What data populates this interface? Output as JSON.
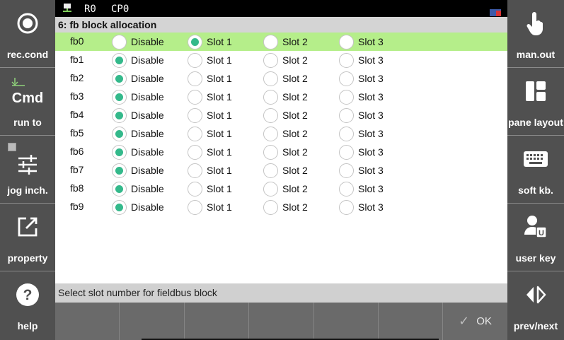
{
  "left_panel": [
    {
      "label": "rec.cond",
      "icon": "record-circle-icon"
    },
    {
      "label": "run to",
      "sublabel": "Cmd",
      "icon": "cmd-icon"
    },
    {
      "label": "jog inch.",
      "icon": "sliders-icon"
    },
    {
      "label": "property",
      "icon": "edit-icon"
    },
    {
      "label": "help",
      "icon": "help-icon"
    }
  ],
  "right_panel": [
    {
      "label": "man.out",
      "icon": "hand-pointer-icon"
    },
    {
      "label": "pane layout",
      "icon": "layout-icon"
    },
    {
      "label": "soft kb.",
      "icon": "keyboard-icon"
    },
    {
      "label": "user key",
      "icon": "user-key-icon"
    },
    {
      "label": "prev/next",
      "icon": "prev-next-icon"
    }
  ],
  "topbar": {
    "robot": "R0",
    "cp": "CP0"
  },
  "title": "6: fb block allocation",
  "options": [
    "Disable",
    "Slot 1",
    "Slot 2",
    "Slot 3"
  ],
  "rows": [
    {
      "label": "fb0",
      "selected": 1
    },
    {
      "label": "fb1",
      "selected": 0
    },
    {
      "label": "fb2",
      "selected": 0
    },
    {
      "label": "fb3",
      "selected": 0
    },
    {
      "label": "fb4",
      "selected": 0
    },
    {
      "label": "fb5",
      "selected": 0
    },
    {
      "label": "fb6",
      "selected": 0
    },
    {
      "label": "fb7",
      "selected": 0
    },
    {
      "label": "fb8",
      "selected": 0
    },
    {
      "label": "fb9",
      "selected": 0
    }
  ],
  "highlighted_row": 0,
  "status": "Select slot number for fieldbus block",
  "function_keys": [
    "",
    "",
    "",
    "",
    "",
    "",
    "OK"
  ],
  "colors": {
    "selected_row": "#b5ee8a",
    "radio_on": "#34b98b",
    "panel": "#505050"
  }
}
